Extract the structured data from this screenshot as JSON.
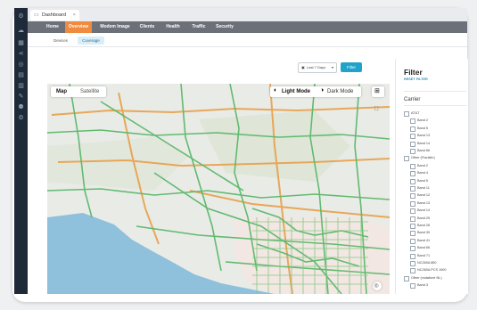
{
  "window": {
    "tab_title": "Dashboard",
    "close_glyph": "×"
  },
  "nav": {
    "items": [
      "Home",
      "Overview",
      "Modem Image",
      "Clients",
      "Health",
      "Traffic",
      "Security"
    ],
    "active": "Overview"
  },
  "subtabs": {
    "items": [
      "Devices",
      "Coverage"
    ],
    "active": "Coverage"
  },
  "toolbar": {
    "date_range": "Last 7 Days",
    "filter_button": "Filter"
  },
  "map": {
    "map_type": [
      "Map",
      "Satellite"
    ],
    "selected_map_type": "Map",
    "light_mode": "Light Mode",
    "dark_mode": "Dark Mode",
    "selected_mode": "Light Mode"
  },
  "filter_panel": {
    "title": "Filter",
    "reset": "RESET FILTER",
    "section": "Carrier",
    "items": [
      {
        "label": "AT&T",
        "level": 0
      },
      {
        "label": "Band 2",
        "level": 1
      },
      {
        "label": "Band 5",
        "level": 1
      },
      {
        "label": "Band 13",
        "level": 1
      },
      {
        "label": "Band 14",
        "level": 1
      },
      {
        "label": "Band 66",
        "level": 1
      },
      {
        "label": "Other (Franklin)",
        "level": 0
      },
      {
        "label": "Band 2",
        "level": 1
      },
      {
        "label": "Band 4",
        "level": 1
      },
      {
        "label": "Band 5",
        "level": 1
      },
      {
        "label": "Band 11",
        "level": 1
      },
      {
        "label": "Band 12",
        "level": 1
      },
      {
        "label": "Band 13",
        "level": 1
      },
      {
        "label": "Band 14",
        "level": 1
      },
      {
        "label": "Band 25",
        "level": 1
      },
      {
        "label": "Band 26",
        "level": 1
      },
      {
        "label": "Band 30",
        "level": 1
      },
      {
        "label": "Band 41",
        "level": 1
      },
      {
        "label": "Band 66",
        "level": 1
      },
      {
        "label": "Band 71",
        "level": 1
      },
      {
        "label": "NC260A 850",
        "level": 1
      },
      {
        "label": "NC260A PCS 1900",
        "level": 1
      },
      {
        "label": "Other (vodafone NL)",
        "level": 0
      },
      {
        "label": "Band 3",
        "level": 1
      }
    ]
  },
  "colors": {
    "sidebar": "#1e2a38",
    "nav": "#6c7079",
    "nav_active": "#ef8a3e",
    "accent": "#21a3c9",
    "water": "#8fc0dc",
    "coverage_green": "#5bb86a",
    "coverage_orange": "#e8a04a"
  },
  "icons": [
    "gear-icon",
    "cloud-icon",
    "dashboard-icon",
    "share-icon",
    "globe-icon",
    "document-icon",
    "chart-icon",
    "tool-icon",
    "user-icon",
    "settings-icon",
    "grid-icon",
    "fullscreen-icon",
    "locate-icon",
    "calendar-icon",
    "chevron-down-icon"
  ]
}
